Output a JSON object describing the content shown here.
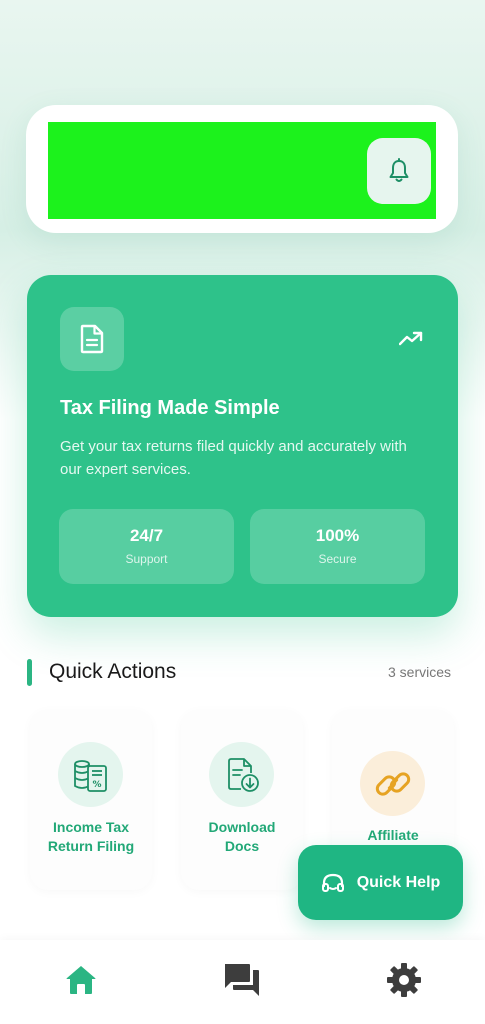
{
  "header": {
    "notification_icon": "bell-icon"
  },
  "hero": {
    "doc_icon": "document-icon",
    "trend_icon": "trending-up-icon",
    "title": "Tax Filing Made Simple",
    "description": "Get your tax returns filed quickly and accurately with our expert services.",
    "stats": [
      {
        "value": "24/7",
        "label": "Support"
      },
      {
        "value": "100%",
        "label": "Secure"
      }
    ]
  },
  "quick_actions": {
    "title": "Quick Actions",
    "count": "3 services",
    "services": [
      {
        "line1": "Income Tax",
        "line2": "Return Filing",
        "icon": "tax-calculator-icon"
      },
      {
        "line1": "Download",
        "line2": "Docs",
        "icon": "download-doc-icon"
      },
      {
        "line1": "Affiliate",
        "icon": "link-icon"
      }
    ]
  },
  "quick_help": {
    "label": "Quick Help",
    "icon": "headset-icon"
  },
  "bottom_nav": {
    "items": [
      {
        "name": "home",
        "icon": "home-icon",
        "active": true
      },
      {
        "name": "messages",
        "icon": "chat-icon",
        "active": false
      },
      {
        "name": "settings",
        "icon": "gear-icon",
        "active": false
      }
    ]
  },
  "colors": {
    "primary": "#2ec28a",
    "accent_text": "#22a877",
    "nav_active": "#2bb583",
    "nav_inactive": "#3d3d3d"
  }
}
